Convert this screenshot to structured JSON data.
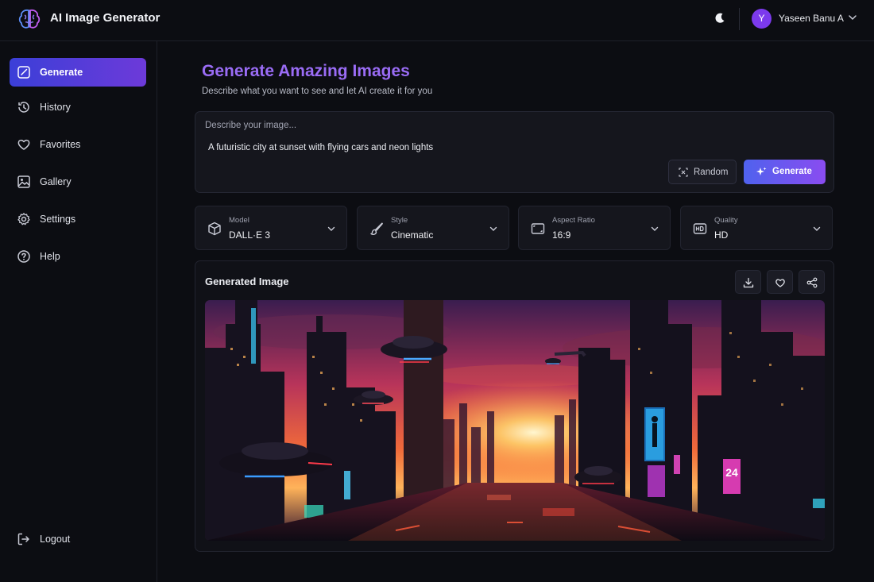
{
  "header": {
    "app_title": "AI Image Generator",
    "user": {
      "initial": "Y",
      "name": "Yaseen Banu A"
    },
    "icons": [
      "brain-logo-icon",
      "moon-icon",
      "chevron-down-icon"
    ]
  },
  "sidebar": {
    "items": [
      {
        "label": "Generate",
        "icon": "wand-icon",
        "active": true
      },
      {
        "label": "History",
        "icon": "clock-icon",
        "active": false
      },
      {
        "label": "Favorites",
        "icon": "heart-icon",
        "active": false
      },
      {
        "label": "Gallery",
        "icon": "image-icon",
        "active": false
      },
      {
        "label": "Settings",
        "icon": "gear-icon",
        "active": false
      },
      {
        "label": "Help",
        "icon": "help-icon",
        "active": false
      }
    ],
    "logout_label": "Logout"
  },
  "main": {
    "heading": "Generate Amazing Images",
    "subheading": "Describe what you want to see and let AI create it for you",
    "prompt": {
      "label": "Describe your image...",
      "value": "A futuristic city at sunset with flying cars and neon lights",
      "random_label": "Random",
      "generate_label": "Generate"
    },
    "options": [
      {
        "label": "Model",
        "value": "DALL·E 3",
        "icon": "cube-icon"
      },
      {
        "label": "Style",
        "value": "Cinematic",
        "icon": "brush-icon"
      },
      {
        "label": "Aspect Ratio",
        "value": "16:9",
        "icon": "aspect-ratio-icon"
      },
      {
        "label": "Quality",
        "value": "HD",
        "icon": "hd-icon"
      }
    ],
    "result": {
      "title": "Generated Image",
      "actions": [
        "download-icon",
        "heart-icon",
        "share-icon"
      ],
      "image_sign_text": "24"
    }
  },
  "colors": {
    "accent_start": "#3b3fd8",
    "accent_end": "#8a4cf0",
    "heading": "#9a6cf5",
    "background": "#0c0d12"
  }
}
